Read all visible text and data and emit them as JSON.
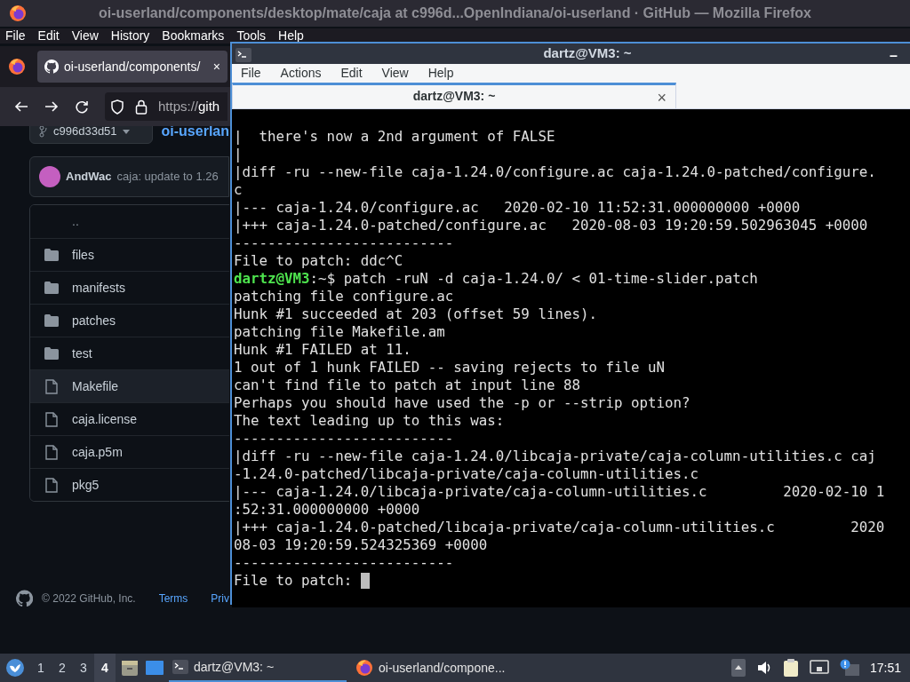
{
  "firefox": {
    "title": "oi-userland/components/desktop/mate/caja at c996d...OpenIndiana/oi-userland · GitHub — Mozilla Firefox",
    "menu": [
      "File",
      "Edit",
      "View",
      "History",
      "Bookmarks",
      "Tools",
      "Help"
    ],
    "tab": {
      "label": "oi-userland/components/",
      "close": "×"
    },
    "url": {
      "scheme": "https://",
      "host": "gith"
    },
    "branch": "c996d33d51",
    "breadcrumb": "oi-userlan",
    "commit": {
      "author": "AndWac",
      "message": "caja: update to 1.26"
    },
    "files": [
      {
        "name": "..",
        "kind": "parent",
        "hovered": false
      },
      {
        "name": "files",
        "kind": "folder",
        "hovered": false
      },
      {
        "name": "manifests",
        "kind": "folder",
        "hovered": false
      },
      {
        "name": "patches",
        "kind": "folder",
        "hovered": false
      },
      {
        "name": "test",
        "kind": "folder",
        "hovered": false
      },
      {
        "name": "Makefile",
        "kind": "file",
        "hovered": true
      },
      {
        "name": "caja.license",
        "kind": "file",
        "hovered": false
      },
      {
        "name": "caja.p5m",
        "kind": "file",
        "hovered": false
      },
      {
        "name": "pkg5",
        "kind": "file",
        "hovered": false
      }
    ],
    "footer": {
      "copyright": "© 2022 GitHub, Inc.",
      "links": [
        "Terms",
        "Priv"
      ]
    }
  },
  "terminal": {
    "title": "dartz@VM3: ~",
    "minimize": "–",
    "menu": [
      "File",
      "Actions",
      "Edit",
      "View",
      "Help"
    ],
    "tab": {
      "label": "dartz@VM3: ~",
      "close": "×"
    },
    "lines": [
      {
        "kind": "text",
        "text": "|  there's now a 2nd argument of FALSE"
      },
      {
        "kind": "text",
        "text": "|"
      },
      {
        "kind": "text",
        "text": "|diff -ru --new-file caja-1.24.0/configure.ac caja-1.24.0-patched/configure."
      },
      {
        "kind": "text",
        "text": "c"
      },
      {
        "kind": "text",
        "text": "|--- caja-1.24.0/configure.ac   2020-02-10 11:52:31.000000000 +0000"
      },
      {
        "kind": "text",
        "text": "|+++ caja-1.24.0-patched/configure.ac   2020-08-03 19:20:59.502963045 +0000"
      },
      {
        "kind": "text",
        "text": "--------------------------"
      },
      {
        "kind": "text",
        "text": "File to patch: ddc^C"
      },
      {
        "kind": "prompt",
        "user": "dartz@VM3",
        "text": ":~$ patch -ruN -d caja-1.24.0/ < 01-time-slider.patch"
      },
      {
        "kind": "text",
        "text": "patching file configure.ac"
      },
      {
        "kind": "text",
        "text": "Hunk #1 succeeded at 203 (offset 59 lines)."
      },
      {
        "kind": "text",
        "text": "patching file Makefile.am"
      },
      {
        "kind": "text",
        "text": "Hunk #1 FAILED at 11."
      },
      {
        "kind": "text",
        "text": "1 out of 1 hunk FAILED -- saving rejects to file uN"
      },
      {
        "kind": "text",
        "text": "can't find file to patch at input line 88"
      },
      {
        "kind": "text",
        "text": "Perhaps you should have used the -p or --strip option?"
      },
      {
        "kind": "text",
        "text": "The text leading up to this was:"
      },
      {
        "kind": "text",
        "text": "--------------------------"
      },
      {
        "kind": "text",
        "text": "|diff -ru --new-file caja-1.24.0/libcaja-private/caja-column-utilities.c caj"
      },
      {
        "kind": "text",
        "text": "-1.24.0-patched/libcaja-private/caja-column-utilities.c"
      },
      {
        "kind": "text",
        "text": "|--- caja-1.24.0/libcaja-private/caja-column-utilities.c         2020-02-10 1"
      },
      {
        "kind": "text",
        "text": ":52:31.000000000 +0000"
      },
      {
        "kind": "text",
        "text": "|+++ caja-1.24.0-patched/libcaja-private/caja-column-utilities.c         2020"
      },
      {
        "kind": "text",
        "text": "08-03 19:20:59.524325369 +0000"
      },
      {
        "kind": "text",
        "text": "--------------------------"
      },
      {
        "kind": "input",
        "text": "File to patch: "
      }
    ]
  },
  "taskbar": {
    "workspaces": [
      {
        "label": "1",
        "selected": false
      },
      {
        "label": "2",
        "selected": false
      },
      {
        "label": "3",
        "selected": false
      },
      {
        "label": "4",
        "selected": true
      }
    ],
    "tasks": [
      {
        "label": "dartz@VM3: ~",
        "kind": "terminal",
        "selected": true
      },
      {
        "label": "oi-userland/compone...",
        "kind": "browser",
        "selected": false
      }
    ],
    "clock": "17:51"
  }
}
